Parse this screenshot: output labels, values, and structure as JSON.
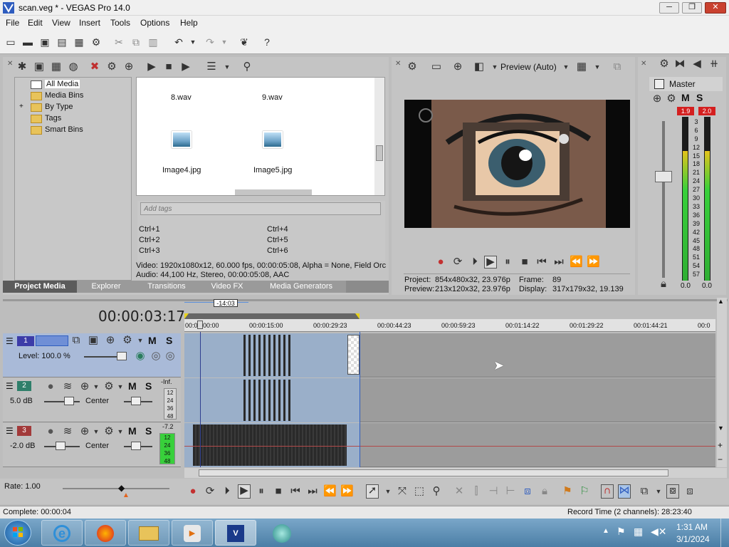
{
  "window": {
    "title": "scan.veg * - VEGAS Pro 14.0",
    "minimize": "─",
    "maximize": "❐",
    "close": "✕"
  },
  "menu": [
    "File",
    "Edit",
    "View",
    "Insert",
    "Tools",
    "Options",
    "Help"
  ],
  "media_panel": {
    "tree": [
      "All Media",
      "Media Bins",
      "By Type",
      "Tags",
      "Smart Bins"
    ],
    "tree_expander": "+",
    "files": [
      {
        "name": "8.wav"
      },
      {
        "name": "9.wav"
      },
      {
        "name": "Image4.jpg"
      },
      {
        "name": "Image5.jpg"
      }
    ],
    "tags_placeholder": "Add tags",
    "shortcuts": [
      "Ctrl+1",
      "Ctrl+2",
      "Ctrl+3",
      "Ctrl+4",
      "Ctrl+5",
      "Ctrl+6"
    ],
    "video_info": "Video: 1920x1080x12, 60.000 fps, 00:00:05:08, Alpha = None, Field Orc",
    "audio_info": "Audio: 44,100 Hz, Stereo, 00:00:05:08, AAC",
    "tabs": [
      "Project Media",
      "Explorer",
      "Transitions",
      "Video FX",
      "Media Generators"
    ]
  },
  "preview": {
    "mode": "Preview (Auto)",
    "project_label": "Project:",
    "project_value": "854x480x32, 23.976p",
    "frame_label": "Frame:",
    "frame_value": "89",
    "preview_label": "Preview:",
    "preview_value": "213x120x32, 23.976p",
    "display_label": "Display:",
    "display_value": "317x179x32, 19.139"
  },
  "master": {
    "label": "Master",
    "m_label": "M",
    "s_label": "S",
    "peak_left": "1.9",
    "peak_right": "2.0",
    "scale": [
      "3",
      "6",
      "9",
      "12",
      "15",
      "18",
      "21",
      "24",
      "27",
      "30",
      "33",
      "36",
      "39",
      "42",
      "45",
      "48",
      "51",
      "54",
      "57"
    ],
    "level_left": "0.0",
    "level_right": "0.0",
    "fill_left": 0.8,
    "fill_right": 0.8
  },
  "timeline": {
    "timecode": "00:00:03:17",
    "marker": "-14:03",
    "ruler": [
      "00:00:00:00",
      "00:00:15:00",
      "00:00:29:23",
      "00:00:44:23",
      "00:00:59:23",
      "00:01:14:22",
      "00:01:29:22",
      "00:01:44:21",
      "00:0"
    ],
    "tracks": [
      {
        "num": "1",
        "type": "video",
        "level_label": "Level: 100.0 %",
        "m": "M",
        "s": "S"
      },
      {
        "num": "2",
        "type": "audio",
        "vol": "5.0 dB",
        "pan": "Center",
        "peak": "-Inf.",
        "m": "M",
        "s": "S",
        "scale": [
          "12",
          "24",
          "36",
          "48"
        ]
      },
      {
        "num": "3",
        "type": "audio",
        "vol": "-2.0 dB",
        "pan": "Center",
        "peak": "-7.2",
        "m": "M",
        "s": "S",
        "scale": [
          "12",
          "24",
          "36",
          "48"
        ]
      }
    ],
    "rate": "Rate: 1.00"
  },
  "status": {
    "left": "Complete: 00:00:04",
    "right": "Record Time (2 channels): 28:23:40"
  },
  "clock": {
    "time": "1:31 AM",
    "date": "3/1/2024"
  },
  "colors": {
    "accent_blue": "#2f5dbf",
    "track1": "#3c3ca8",
    "track2": "#2f7f6a",
    "track3": "#a23a3a",
    "clip": "#9aafc9",
    "meter_green": "#38d03b"
  }
}
